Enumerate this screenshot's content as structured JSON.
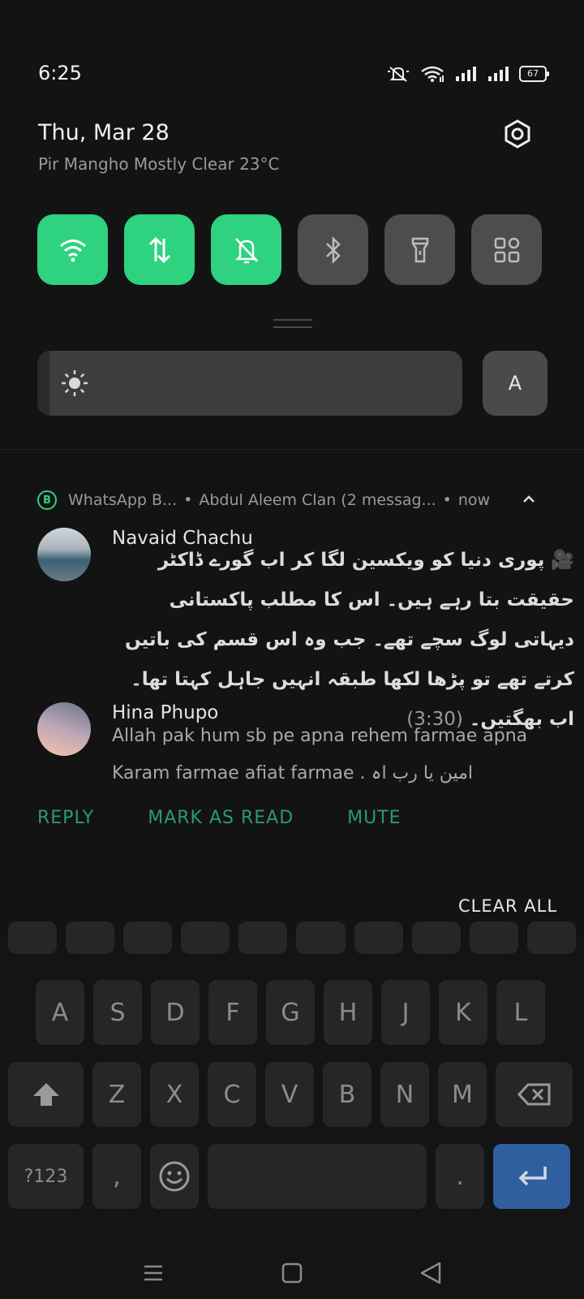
{
  "status_bar": {
    "time": "6:25",
    "battery": "67"
  },
  "header": {
    "date": "Thu, Mar 28",
    "weather": "Pir Mangho Mostly Clear 23°C"
  },
  "quick_tiles": [
    {
      "name": "wifi",
      "state": "on"
    },
    {
      "name": "mobile-data",
      "state": "on"
    },
    {
      "name": "silent",
      "state": "on"
    },
    {
      "name": "bluetooth",
      "state": "off"
    },
    {
      "name": "flashlight",
      "state": "off"
    },
    {
      "name": "more",
      "state": "off"
    }
  ],
  "brightness": {
    "auto_label": "A"
  },
  "notification": {
    "app_badge": "B",
    "app_name": "WhatsApp B...",
    "group": "Abdul Aleem Clan (2 messag...",
    "time": "now",
    "messages": [
      {
        "sender": "Navaid Chachu",
        "text": "🎥 پوری دنیا کو ویکسین لگا کر اب گورے ڈاکٹر حقیقت بتا رہے ہیں۔ اس کا مطلب پاکستانی دیہاتی لوگ سچے تھے۔ جب وہ اس قسم کی باتیں کرتے تھے تو پڑھا لکھا طبقہ انہیں جاہل کہتا تھا۔ اب بھگتیں۔",
        "duration": "(3:30)"
      },
      {
        "sender": "Hina Phupo",
        "text": "Allah pak hum sb pe apna rehem farmae apna Karam farmae afiat farmae . امین یا رب اہ"
      }
    ],
    "actions": {
      "reply": "REPLY",
      "mark_read": "MARK AS READ",
      "mute": "MUTE"
    }
  },
  "clear_all": "CLEAR ALL",
  "keyboard": {
    "row2": [
      "A",
      "S",
      "D",
      "F",
      "G",
      "H",
      "J",
      "K",
      "L"
    ],
    "row3": [
      "Z",
      "X",
      "C",
      "V",
      "B",
      "N",
      "M"
    ],
    "symbols": "?123",
    "comma": ",",
    "period": "."
  },
  "colors": {
    "accent": "#2fd27f",
    "action_text": "#2a9b6a",
    "enter_key": "#2f5f9f"
  }
}
